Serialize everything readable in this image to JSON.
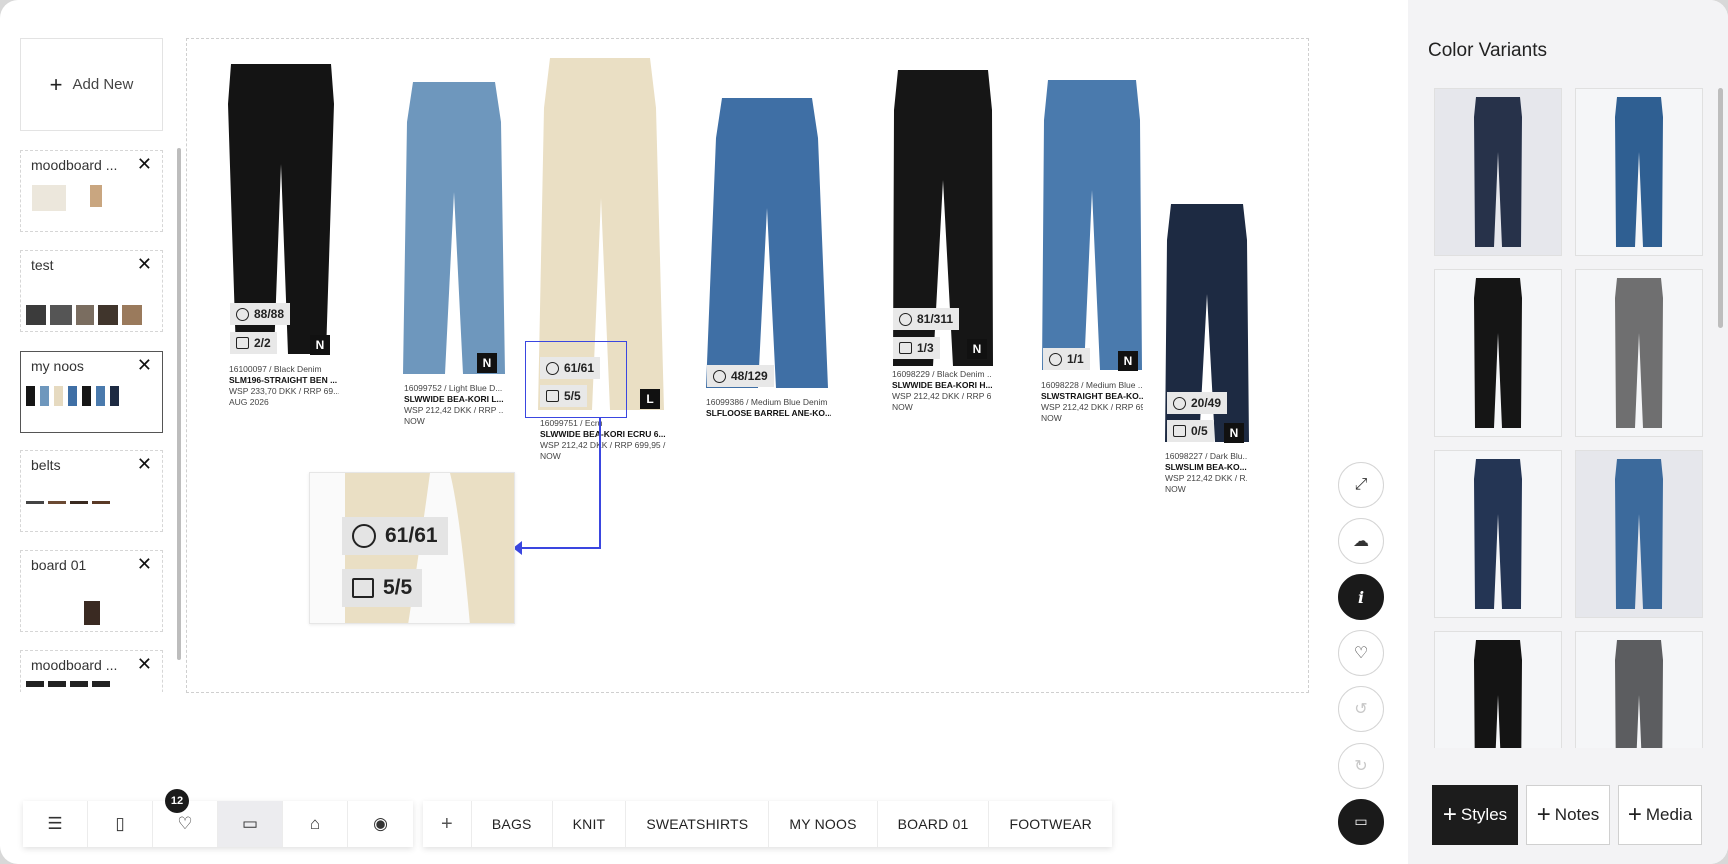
{
  "sidebar": {
    "add_new_label": "Add New",
    "boards": [
      {
        "title": "moodboard ...",
        "active": false
      },
      {
        "title": "test",
        "active": false
      },
      {
        "title": "my noos",
        "active": true
      },
      {
        "title": "belts",
        "active": false
      },
      {
        "title": "board 01",
        "active": false
      },
      {
        "title": "moodboard ...",
        "active": false
      }
    ]
  },
  "products": [
    {
      "stock": "88/88",
      "boxes": "2/2",
      "badge": "N",
      "line1": "16100097 / Black Denim",
      "name": "SLM196-STRAIGHT BEN ...",
      "price": "WSP 233,70 DKK / RRP 69...",
      "delivery": "AUG 2026",
      "color": "#141414"
    },
    {
      "stock": "",
      "boxes": "",
      "badge": "N",
      "line1": "16099752 / Light Blue D...",
      "name": "SLWWIDE BEA-KORI L...",
      "price": "WSP 212,42 DKK / RRP ...",
      "delivery": "NOW",
      "color": "#6e97bd"
    },
    {
      "stock": "61/61",
      "boxes": "5/5",
      "badge": "L",
      "line1": "16099751 / Ecru",
      "name": "SLWWIDE BEA-KORI ECRU 6...",
      "price": "WSP 212,42 DKK / RRP 699,95 / ...",
      "delivery": "NOW",
      "color": "#eadfc4"
    },
    {
      "stock": "48/129",
      "boxes": "",
      "badge": "",
      "line1": "16099386 / Medium Blue Denim",
      "name": "SLFLOOSE BARREL ANE-KO...",
      "price": "",
      "delivery": "",
      "color": "#3f6fa5"
    },
    {
      "stock": "81/311",
      "boxes": "1/3",
      "badge": "N",
      "line1": "16098229 / Black Denim ...",
      "name": "SLWWIDE BEA-KORI H...",
      "price": "WSP 212,42 DKK / RRP 6...",
      "delivery": "NOW",
      "color": "#161616"
    },
    {
      "stock": "1/1",
      "boxes": "",
      "badge": "N",
      "line1": "16098228 / Medium Blue ...",
      "name": "SLWSTRAIGHT BEA-KO...",
      "price": "WSP 212,42 DKK / RRP 69...",
      "delivery": "NOW",
      "color": "#4a7aad"
    },
    {
      "stock": "20/49",
      "boxes": "0/5",
      "badge": "N",
      "line1": "16098227 / Dark Blu...",
      "name": "SLWSLIM BEA-KO...",
      "price": "WSP 212,42 DKK / R...",
      "delivery": "NOW",
      "color": "#1d2a42"
    }
  ],
  "zoom": {
    "stock": "61/61",
    "boxes": "5/5"
  },
  "tools": [
    "expand-icon",
    "upload-cloud-icon",
    "info-icon",
    "heart-icon",
    "undo-icon",
    "redo-icon",
    "present-icon"
  ],
  "right_panel": {
    "title": "Color Variants",
    "variant_colors": [
      "#27324a",
      "#2f5f92",
      "#151515",
      "#6f6f70",
      "#243554",
      "#3c6a9c",
      "#141414",
      "#5c5d60"
    ],
    "buttons": {
      "styles": "Styles",
      "notes": "Notes",
      "media": "Media"
    }
  },
  "bottom_bar": {
    "icons": [
      "menu-icon",
      "notebook-icon",
      "heart-icon",
      "monitor-icon",
      "bag-icon",
      "eye-icon"
    ],
    "favorites_count": "12",
    "tabs": [
      "BAGS",
      "KNIT",
      "SWEATSHIRTS",
      "MY NOOS",
      "BOARD 01",
      "FOOTWEAR"
    ]
  }
}
